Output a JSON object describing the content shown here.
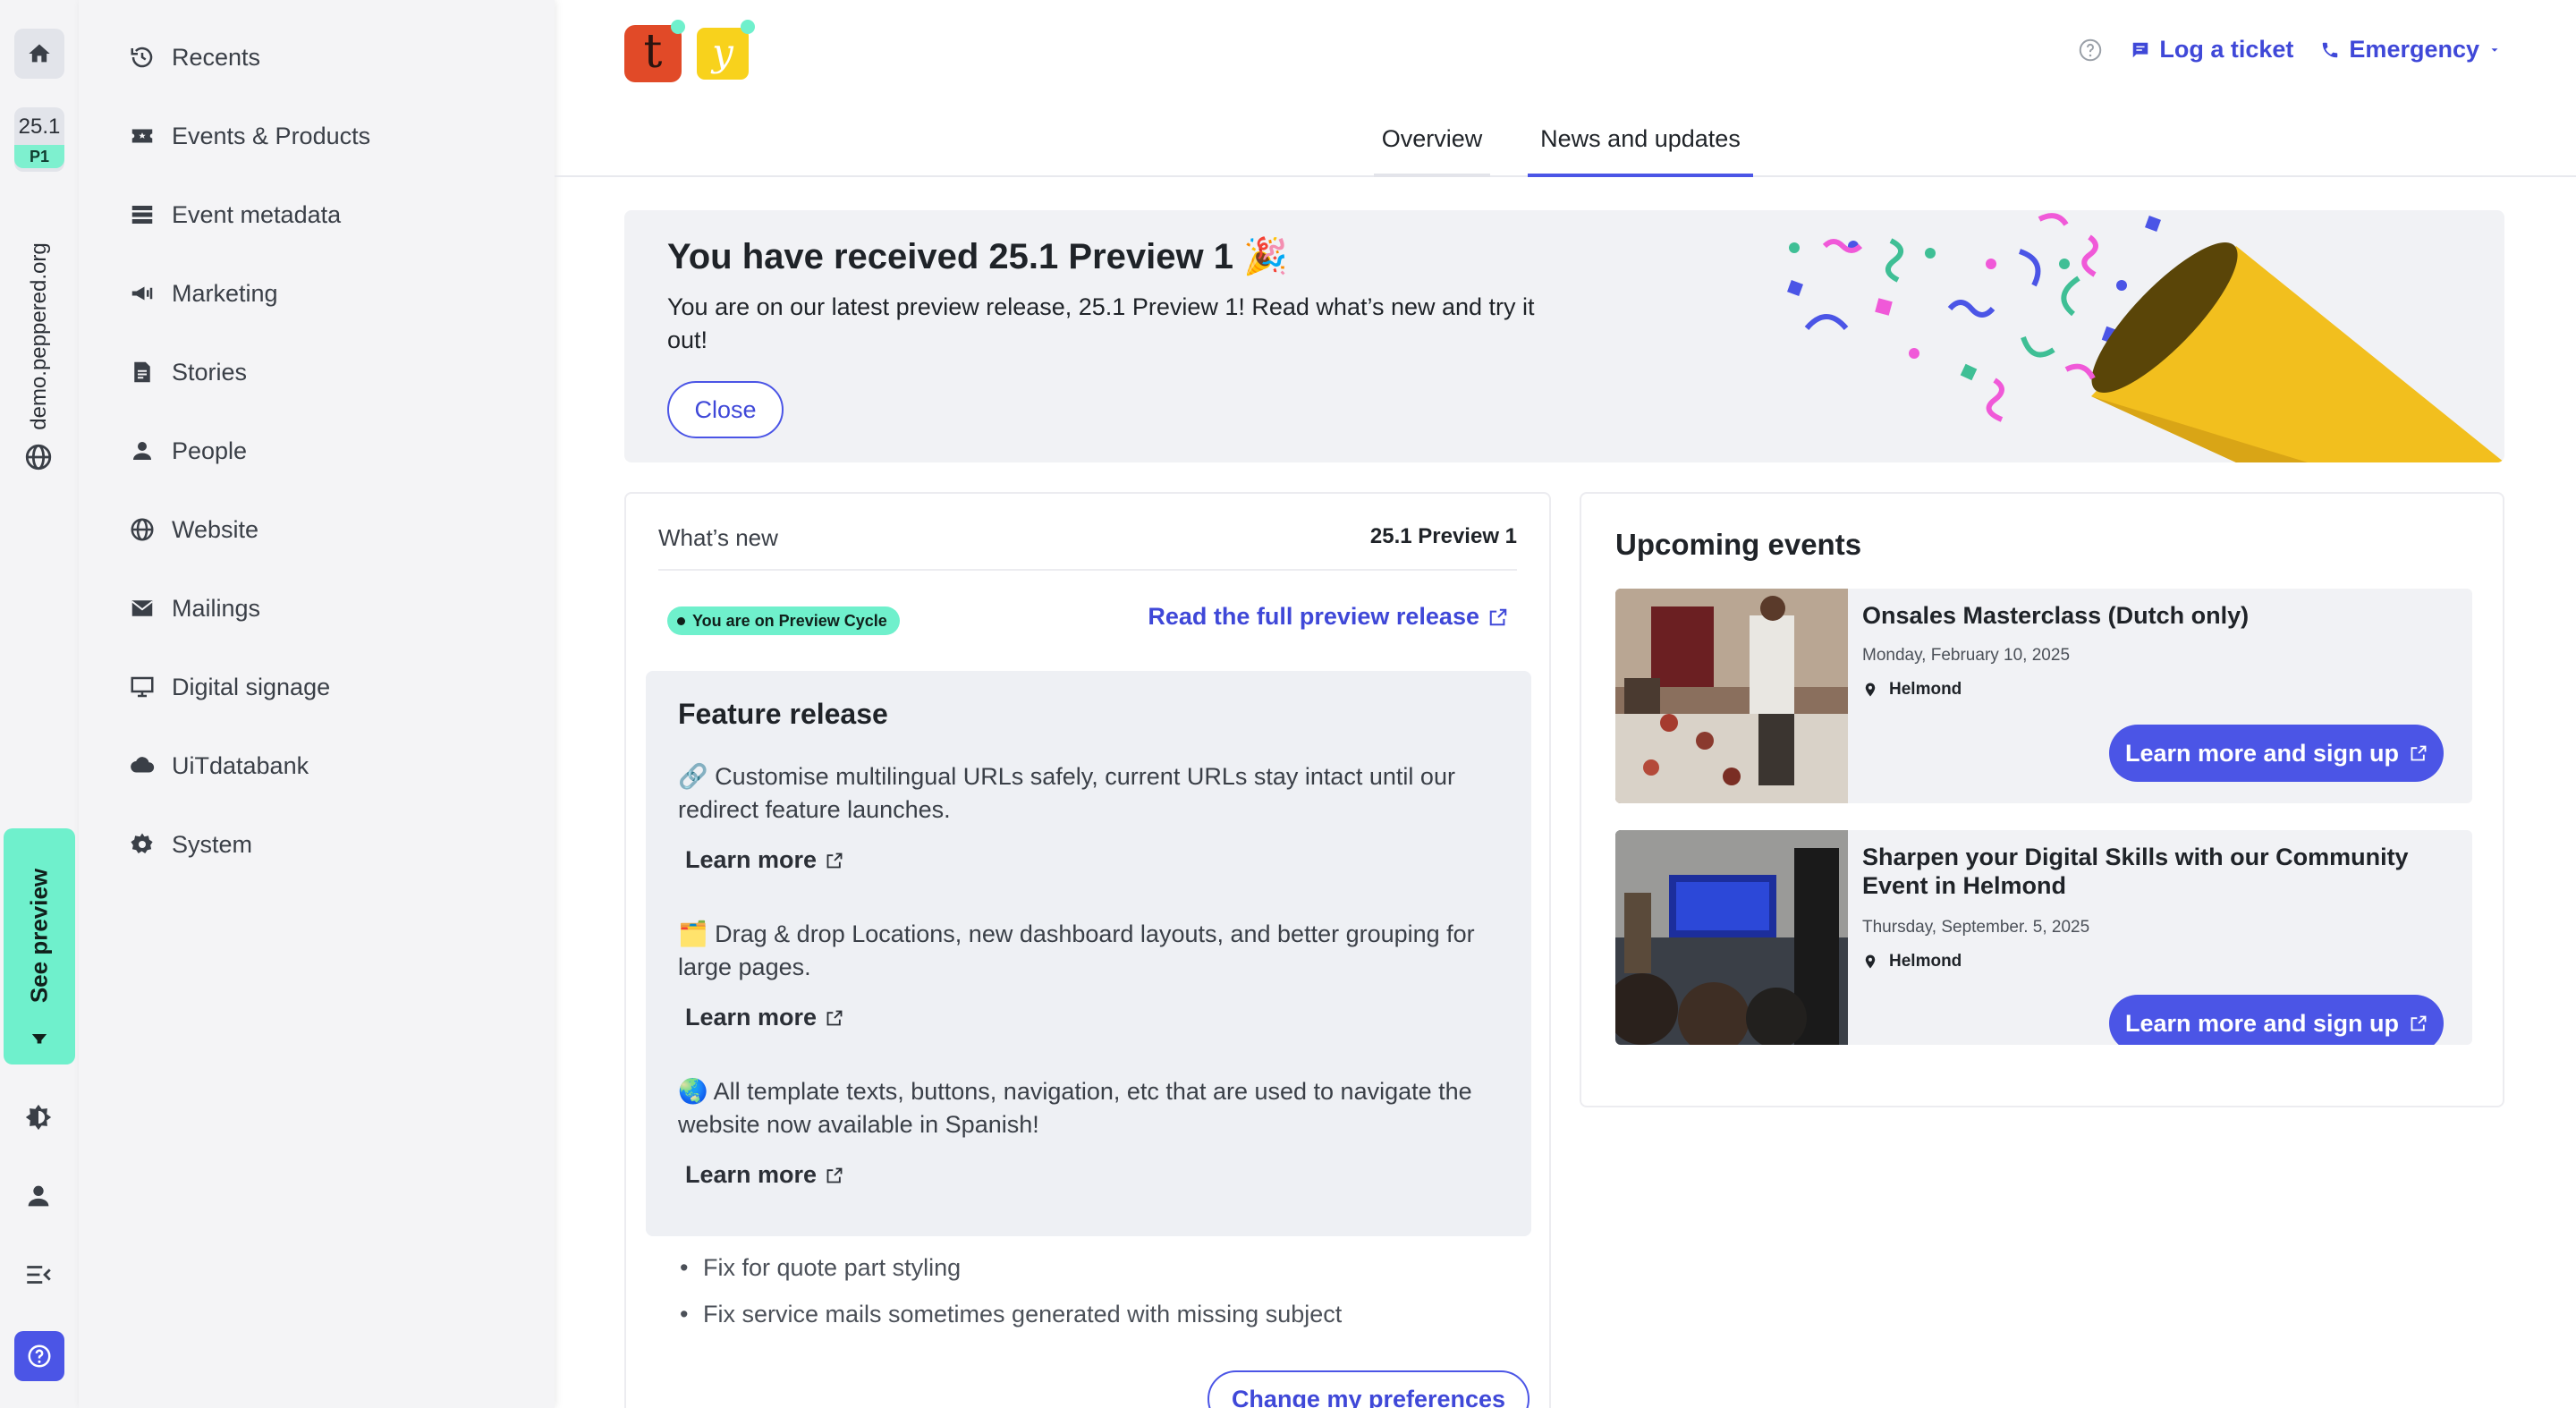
{
  "rail": {
    "version": "25.1",
    "version_badge": "P1",
    "domain": "demo.peppered.org",
    "see_preview": "See preview"
  },
  "sidebar": {
    "items": [
      {
        "label": "Recents",
        "icon": "history-icon"
      },
      {
        "label": "Events & Products",
        "icon": "ticket-icon"
      },
      {
        "label": "Event metadata",
        "icon": "storage-icon"
      },
      {
        "label": "Marketing",
        "icon": "megaphone-icon"
      },
      {
        "label": "Stories",
        "icon": "document-icon"
      },
      {
        "label": "People",
        "icon": "person-icon"
      },
      {
        "label": "Website",
        "icon": "globe-icon"
      },
      {
        "label": "Mailings",
        "icon": "mail-icon"
      },
      {
        "label": "Digital signage",
        "icon": "monitor-icon"
      },
      {
        "label": "UiTdatabank",
        "icon": "cloud-icon"
      },
      {
        "label": "System",
        "icon": "gear-icon"
      }
    ]
  },
  "header": {
    "logos": [
      "t",
      "y"
    ],
    "log_ticket": "Log a ticket",
    "emergency": "Emergency"
  },
  "tabs": [
    {
      "label": "Overview",
      "active": false
    },
    {
      "label": "News and updates",
      "active": true
    }
  ],
  "banner": {
    "title": "You have received 25.1 Preview 1",
    "emoji": "🎉",
    "text": "You are on our latest preview release, 25.1 Preview 1! Read what’s new and try it out!",
    "close": "Close"
  },
  "whats_new": {
    "title": "What’s new",
    "version": "25.1 Preview 1",
    "pill": "You are on Preview Cycle",
    "read_full": "Read the full preview release",
    "feature_title": "Feature release",
    "features": [
      {
        "emoji": "🔗",
        "text": "Customise multilingual URLs safely, current URLs stay intact until our redirect feature launches.",
        "learn": "Learn more"
      },
      {
        "emoji": "🗂️",
        "text": "Drag & drop Locations, new dashboard layouts, and better grouping for large pages.",
        "learn": "Learn more"
      },
      {
        "emoji": "🌏",
        "text": "All template texts, buttons, navigation, etc that are used to navigate the website now available in Spanish!",
        "learn": "Learn more"
      }
    ],
    "fixes": [
      "Fix for quote part styling",
      "Fix service mails sometimes generated with missing subject"
    ],
    "preferences": "Change my preferences"
  },
  "upcoming": {
    "title": "Upcoming events",
    "events": [
      {
        "title": "Onsales Masterclass (Dutch only)",
        "date": "Monday, February 10, 2025",
        "location": "Helmond",
        "cta": "Learn more and sign up"
      },
      {
        "title": "Sharpen your Digital Skills with our Community Event in Helmond",
        "date": "Thursday, September. 5, 2025",
        "location": "Helmond",
        "cta": "Learn more and sign up"
      }
    ]
  },
  "colors": {
    "accent": "#4b55e6",
    "mint": "#6ff0cc",
    "sidebar_bg": "#f4f4f6",
    "logo_t": "#e14a28",
    "logo_y": "#f8d21c"
  }
}
